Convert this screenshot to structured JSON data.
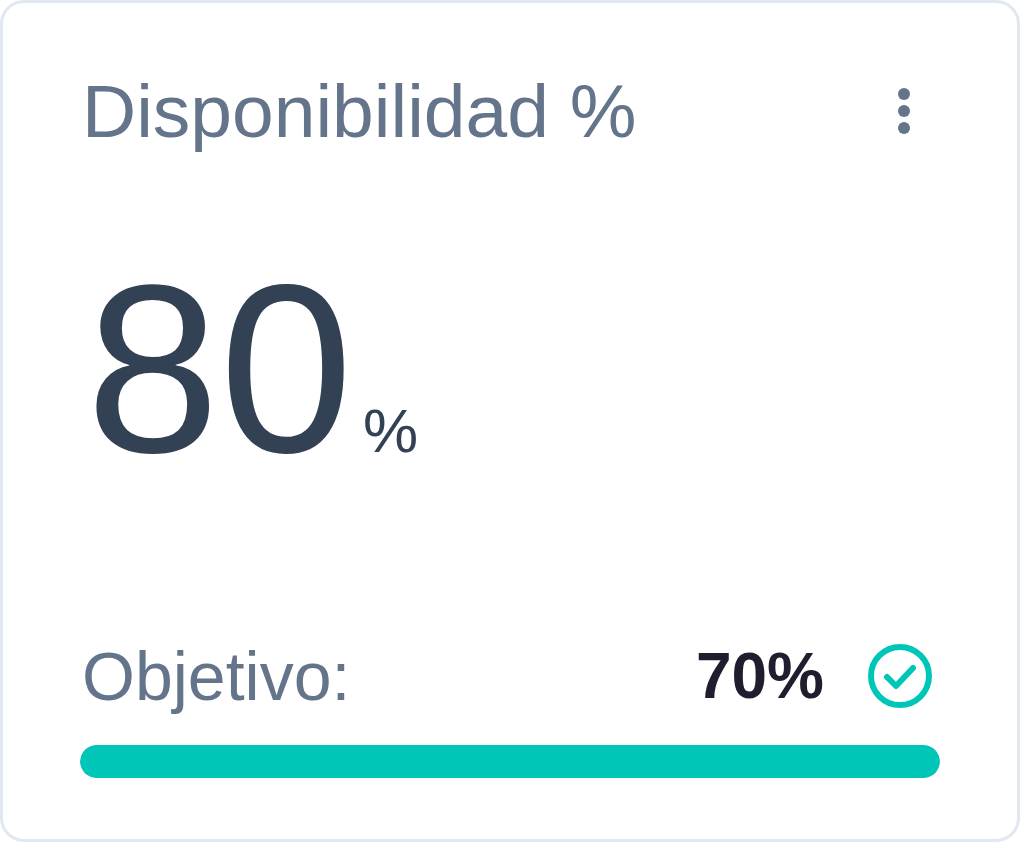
{
  "card": {
    "title": "Disponibilidad %",
    "value": "80",
    "unit": "%",
    "target": {
      "label": "Objetivo:",
      "value": "70%",
      "met": true
    },
    "progress": {
      "level": 1
    }
  }
}
